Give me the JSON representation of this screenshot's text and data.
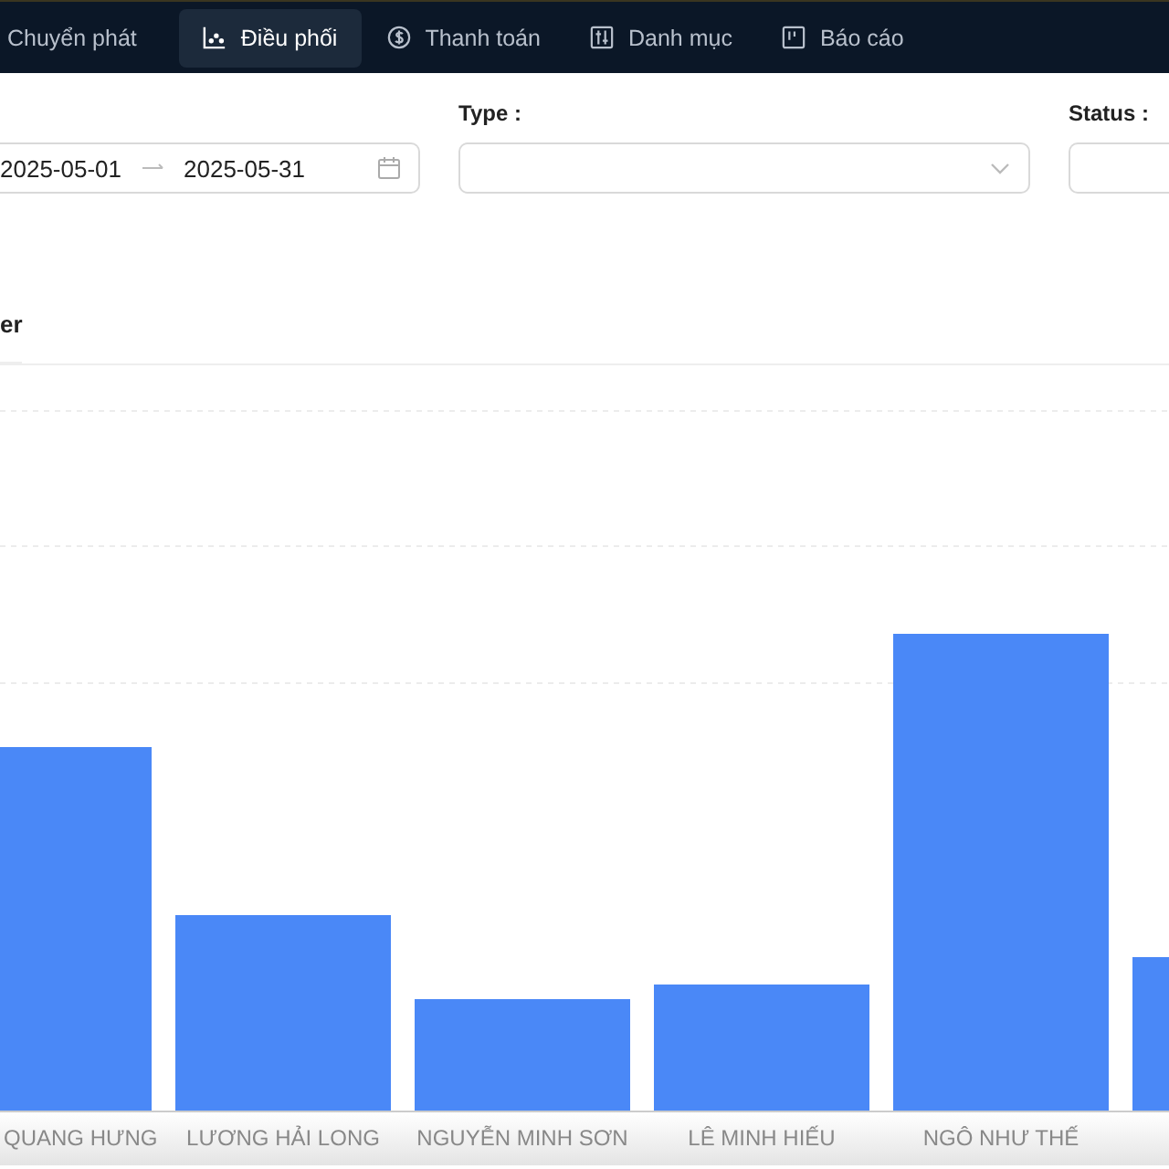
{
  "nav": {
    "tabs": [
      {
        "label": "Chuyển phát",
        "selected": false
      },
      {
        "label": "Điều phối",
        "selected": true
      },
      {
        "label": "Thanh toán",
        "selected": false
      },
      {
        "label": "Danh mục",
        "selected": false
      },
      {
        "label": "Báo cáo",
        "selected": false
      }
    ]
  },
  "filters": {
    "date_from": "2025-05-01",
    "date_to": "2025-05-31",
    "type_label": "Type :",
    "status_label": "Status :"
  },
  "card": {
    "title": "er",
    "chart": {
      "categories": [
        "QUANG HƯNG",
        "LƯƠNG HẢI LONG",
        "NGUYỄN MINH SƠN",
        "LÊ MINH HIẾU",
        "NGÔ NHƯ THẾ"
      ]
    }
  }
}
